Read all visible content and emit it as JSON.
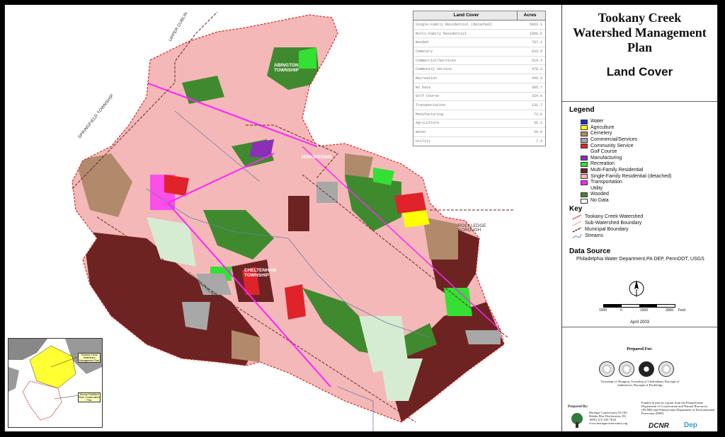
{
  "panel": {
    "title": "Tookany Creek Watershed Management Plan",
    "subtitle": "Land Cover"
  },
  "legend": {
    "heading": "Legend",
    "items": [
      {
        "label": "Water",
        "color": "#1e2bd9"
      },
      {
        "label": "Agriculture",
        "color": "#ffff00"
      },
      {
        "label": "Cemetery",
        "color": "#b08a6a"
      },
      {
        "label": "Commercial/Services",
        "color": "#a8a8a8"
      },
      {
        "label": "Community Service",
        "color": "#e0222a"
      },
      {
        "label": "Golf Course",
        "color": "#ffffff"
      },
      {
        "label": "Manufacturing",
        "color": "#8b2fb8"
      },
      {
        "label": "Recreation",
        "color": "#33e033"
      },
      {
        "label": "Multi-Family Residential",
        "color": "#6e2323"
      },
      {
        "label": "Single-Family Residential (detached)",
        "color": "#f4b8b8"
      },
      {
        "label": "Transportation",
        "color": "#ff22ff"
      },
      {
        "label": "Utility",
        "color": "#ffffff"
      },
      {
        "label": "Wooded",
        "color": "#3f8a2f"
      },
      {
        "label": "No Data",
        "color": "#ffffff"
      }
    ]
  },
  "key": {
    "heading": "Key",
    "items": [
      {
        "label": "Tookany Creek Watershed",
        "icon": "red-dashed-line-icon"
      },
      {
        "label": "Sub-Watershed Boundary",
        "icon": "dashed-line-icon"
      },
      {
        "label": "Municipal Boundary",
        "icon": "brown-dashed-line-icon"
      },
      {
        "label": "Streams",
        "icon": "blue-line-icon"
      }
    ]
  },
  "data_source": {
    "heading": "Data Source",
    "text": "Philadelphia Water Department,PA DEP, PennDOT, USGS"
  },
  "scale": {
    "ticks": [
      "1500",
      "0",
      "1500",
      "3000"
    ],
    "unit": "Feet"
  },
  "date": "April 2003",
  "credits": {
    "prepared_for_heading": "Prepared For:",
    "prepared_for_text": "Township of Abington, Township of Cheltenham, Borough of Jenkintown, Borough of Rockledge",
    "prepared_by_heading": "Prepared By:",
    "prepared_by_text": "Heritage Conservancy 85 Old Dublin Pike Doylestown, PA 18901 215-345-7020 www.heritageconservancy.org",
    "funded_text": "Funded in part by a grant from the Pennsylvania Department of Conservation and Natural Resources (DCNR) and Pennsylvania Department of Environmental Protection (DEP).",
    "logo_dcnr": "DCNR",
    "logo_dep": "Dep"
  },
  "table": {
    "headers": [
      "Land Cover",
      "Acres"
    ],
    "rows": [
      [
        "Single-Family Residential (detached)",
        "5063.1"
      ],
      [
        "Multi-Family Residential",
        "1066.6"
      ],
      [
        "Wooded",
        "787.1"
      ],
      [
        "Cemetery",
        "633.0"
      ],
      [
        "Commercial/Services",
        "514.3"
      ],
      [
        "Community Service",
        "478.3"
      ],
      [
        "Recreation",
        "449.3"
      ],
      [
        "No Data",
        "385.7"
      ],
      [
        "Golf Course",
        "334.9"
      ],
      [
        "Transportation",
        "131.7"
      ],
      [
        "Manufacturing",
        "73.6"
      ],
      [
        "Agriculture",
        "36.1"
      ],
      [
        "Water",
        "34.9"
      ],
      [
        "Utility",
        "7.4"
      ]
    ]
  },
  "map_labels": {
    "upper_dublin": "UPPER DUBLIN",
    "springfield": "SPRINGFIELD TOWNSHIP",
    "abington": "ABINGTON TOWNSHIP",
    "jenkintown": "JENKINTOWN",
    "rockledge": "ROCKLEDGE BOROUGH",
    "cheltenham": "CHELTENHAM TOWNSHIP",
    "philadelphia": "CITY OF PHILADELPHIA"
  },
  "inset": {
    "label1": "Tookany Creek Watershed Management Plan",
    "label2": "Tacony-Frankford River Conservation Plan"
  }
}
